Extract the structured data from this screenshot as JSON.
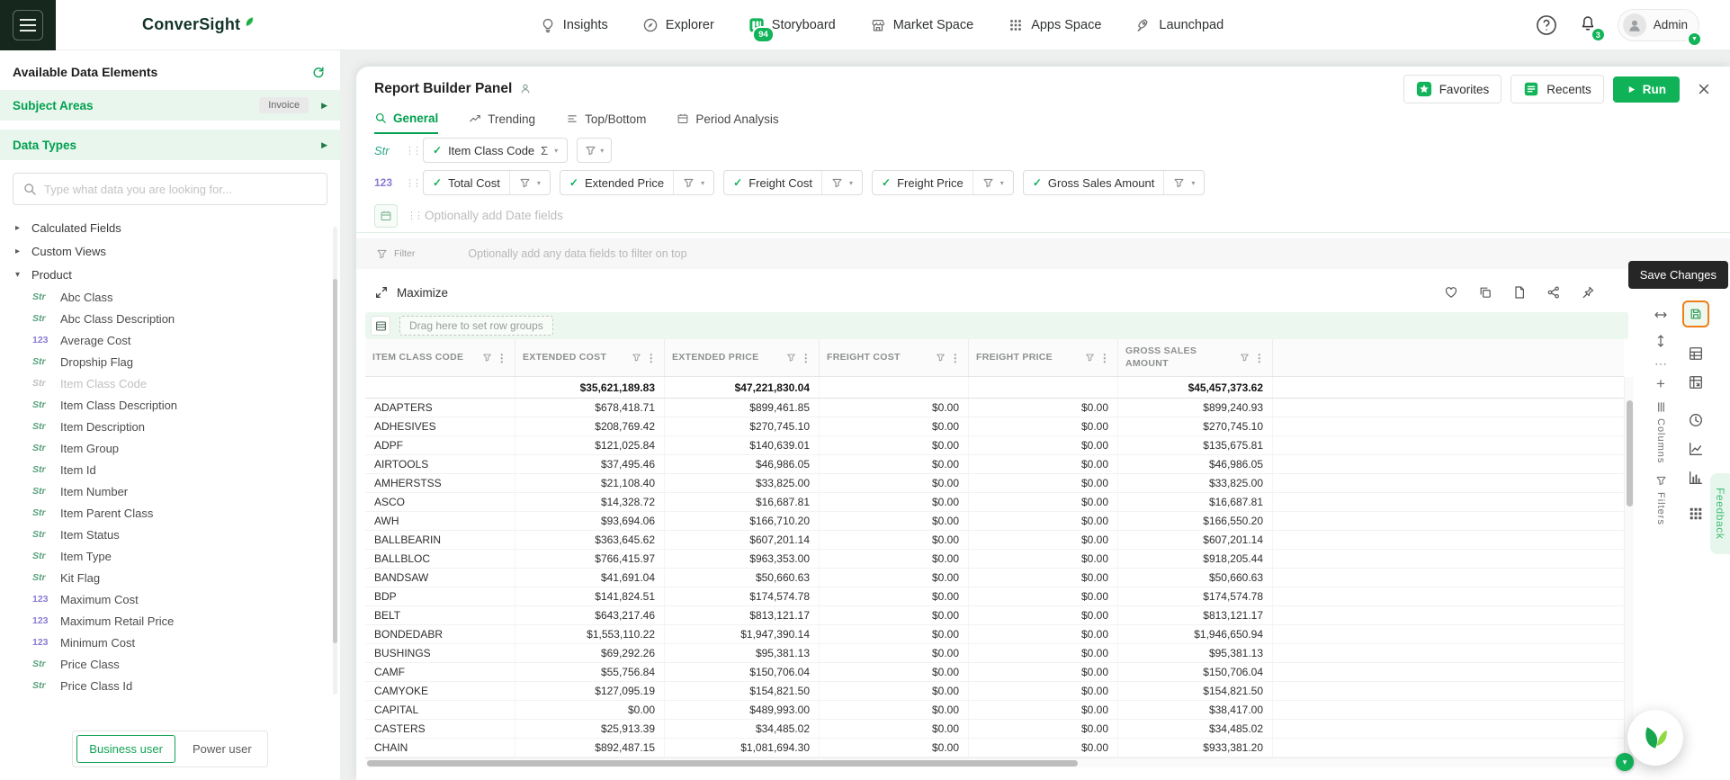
{
  "colors": {
    "accent_green": "#10b257",
    "dark_green": "#16281d",
    "highlight_orange": "#ef7f1a",
    "tooltip_bg": "#262626"
  },
  "topnav": {
    "brand": "ConverSight",
    "items": [
      {
        "label": "Insights",
        "icon": "insights-icon",
        "badge": ""
      },
      {
        "label": "Explorer",
        "icon": "explorer-icon",
        "badge": ""
      },
      {
        "label": "Storyboard",
        "icon": "storyboard-icon",
        "badge": "94"
      },
      {
        "label": "Market Space",
        "icon": "market-space-icon",
        "badge": ""
      },
      {
        "label": "Apps Space",
        "icon": "apps-space-icon",
        "badge": ""
      },
      {
        "label": "Launchpad",
        "icon": "launchpad-icon",
        "badge": ""
      }
    ],
    "notification_badge": "3",
    "user_label": "Admin"
  },
  "sidebar": {
    "title": "Available Data Elements",
    "subject_areas": {
      "label": "Subject Areas",
      "badge": "Invoice"
    },
    "data_types": {
      "label": "Data Types"
    },
    "search_placeholder": "Type what data you are looking for...",
    "collapsed_groups": [
      "Calculated Fields",
      "Custom Views"
    ],
    "expanded_group": "Product",
    "fields": [
      {
        "type": "Str",
        "label": "Abc Class",
        "disabled": false
      },
      {
        "type": "Str",
        "label": "Abc Class Description",
        "disabled": false
      },
      {
        "type": "123",
        "label": "Average Cost",
        "disabled": false
      },
      {
        "type": "Str",
        "label": "Dropship Flag",
        "disabled": false
      },
      {
        "type": "Str",
        "label": "Item Class Code",
        "disabled": true
      },
      {
        "type": "Str",
        "label": "Item Class Description",
        "disabled": false
      },
      {
        "type": "Str",
        "label": "Item Description",
        "disabled": false
      },
      {
        "type": "Str",
        "label": "Item Group",
        "disabled": false
      },
      {
        "type": "Str",
        "label": "Item Id",
        "disabled": false
      },
      {
        "type": "Str",
        "label": "Item Number",
        "disabled": false
      },
      {
        "type": "Str",
        "label": "Item Parent Class",
        "disabled": false
      },
      {
        "type": "Str",
        "label": "Item Status",
        "disabled": false
      },
      {
        "type": "Str",
        "label": "Item Type",
        "disabled": false
      },
      {
        "type": "Str",
        "label": "Kit Flag",
        "disabled": false
      },
      {
        "type": "123",
        "label": "Maximum Cost",
        "disabled": false
      },
      {
        "type": "123",
        "label": "Maximum Retail Price",
        "disabled": false
      },
      {
        "type": "123",
        "label": "Minimum Cost",
        "disabled": false
      },
      {
        "type": "Str",
        "label": "Price Class",
        "disabled": false
      },
      {
        "type": "Str",
        "label": "Price Class Id",
        "disabled": false
      }
    ],
    "footer": {
      "business_user": "Business user",
      "power_user": "Power user"
    }
  },
  "builder": {
    "title": "Report Builder Panel",
    "favorites": "Favorites",
    "recents": "Recents",
    "run": "Run",
    "tabs": [
      {
        "label": "General",
        "icon": "search-icon",
        "active": true
      },
      {
        "label": "Trending",
        "icon": "trending-icon",
        "active": false
      },
      {
        "label": "Top/Bottom",
        "icon": "list-icon",
        "active": false
      },
      {
        "label": "Period Analysis",
        "icon": "calendar-icon",
        "active": false
      }
    ],
    "string_row": {
      "tag": "Str",
      "chips": [
        {
          "label": "Item Class Code",
          "sigma": "Σ"
        }
      ]
    },
    "numeric_row": {
      "tag": "123",
      "chips": [
        "Total Cost",
        "Extended Price",
        "Freight Cost",
        "Freight Price",
        "Gross Sales Amount"
      ]
    },
    "date_row": {
      "placeholder": "Optionally add Date fields"
    },
    "filter_row": {
      "label": "Filter",
      "placeholder": "Optionally add any data fields to filter on top"
    }
  },
  "grid": {
    "maximize": "Maximize",
    "save_tooltip": "Save Changes",
    "drag_hint": "Drag here to set row groups",
    "side_tabs": {
      "columns": "Columns",
      "filters": "Filters"
    },
    "feedback": "Feedback"
  },
  "chart_data": {
    "type": "table",
    "columns": [
      "ITEM CLASS CODE",
      "EXTENDED COST",
      "EXTENDED PRICE",
      "FREIGHT COST",
      "FREIGHT PRICE",
      "GROSS SALES AMOUNT"
    ],
    "totals": [
      "",
      "$35,621,189.83",
      "$47,221,830.04",
      "",
      "",
      "$45,457,373.62"
    ],
    "rows": [
      [
        "ADAPTERS",
        "$678,418.71",
        "$899,461.85",
        "$0.00",
        "$0.00",
        "$899,240.93"
      ],
      [
        "ADHESIVES",
        "$208,769.42",
        "$270,745.10",
        "$0.00",
        "$0.00",
        "$270,745.10"
      ],
      [
        "ADPF",
        "$121,025.84",
        "$140,639.01",
        "$0.00",
        "$0.00",
        "$135,675.81"
      ],
      [
        "AIRTOOLS",
        "$37,495.46",
        "$46,986.05",
        "$0.00",
        "$0.00",
        "$46,986.05"
      ],
      [
        "AMHERSTSS",
        "$21,108.40",
        "$33,825.00",
        "$0.00",
        "$0.00",
        "$33,825.00"
      ],
      [
        "ASCO",
        "$14,328.72",
        "$16,687.81",
        "$0.00",
        "$0.00",
        "$16,687.81"
      ],
      [
        "AWH",
        "$93,694.06",
        "$166,710.20",
        "$0.00",
        "$0.00",
        "$166,550.20"
      ],
      [
        "BALLBEARIN",
        "$363,645.62",
        "$607,201.14",
        "$0.00",
        "$0.00",
        "$607,201.14"
      ],
      [
        "BALLBLOC",
        "$766,415.97",
        "$963,353.00",
        "$0.00",
        "$0.00",
        "$918,205.44"
      ],
      [
        "BANDSAW",
        "$41,691.04",
        "$50,660.63",
        "$0.00",
        "$0.00",
        "$50,660.63"
      ],
      [
        "BDP",
        "$141,824.51",
        "$174,574.78",
        "$0.00",
        "$0.00",
        "$174,574.78"
      ],
      [
        "BELT",
        "$643,217.46",
        "$813,121.17",
        "$0.00",
        "$0.00",
        "$813,121.17"
      ],
      [
        "BONDEDABR",
        "$1,553,110.22",
        "$1,947,390.14",
        "$0.00",
        "$0.00",
        "$1,946,650.94"
      ],
      [
        "BUSHINGS",
        "$69,292.26",
        "$95,381.13",
        "$0.00",
        "$0.00",
        "$95,381.13"
      ],
      [
        "CAMF",
        "$55,756.84",
        "$150,706.04",
        "$0.00",
        "$0.00",
        "$150,706.04"
      ],
      [
        "CAMYOKE",
        "$127,095.19",
        "$154,821.50",
        "$0.00",
        "$0.00",
        "$154,821.50"
      ],
      [
        "CAPITAL",
        "$0.00",
        "$489,993.00",
        "$0.00",
        "$0.00",
        "$38,417.00"
      ],
      [
        "CASTERS",
        "$25,913.39",
        "$34,485.02",
        "$0.00",
        "$0.00",
        "$34,485.02"
      ],
      [
        "CHAIN",
        "$892,487.15",
        "$1,081,694.30",
        "$0.00",
        "$0.00",
        "$933,381.20"
      ]
    ]
  }
}
